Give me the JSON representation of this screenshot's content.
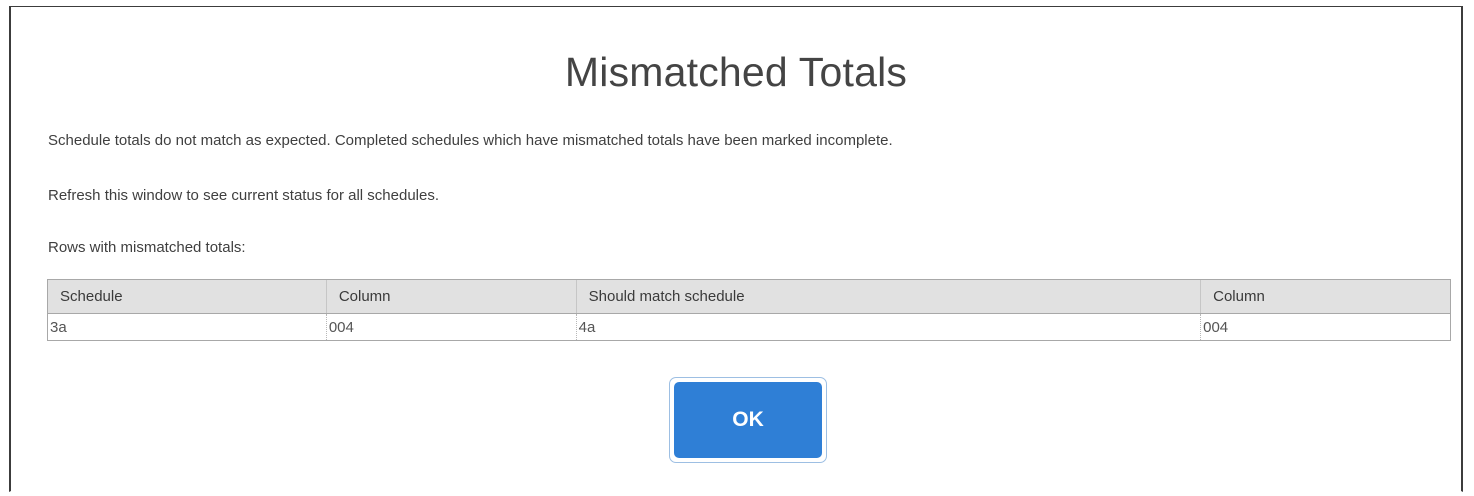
{
  "dialog": {
    "title": "Mismatched Totals",
    "message_1": "Schedule totals do not match as expected. Completed schedules which have mismatched totals have been marked incomplete.",
    "message_2": "Refresh this window to see current status for all schedules.",
    "message_3": "Rows with mismatched totals:",
    "table": {
      "headers": [
        "Schedule",
        "Column",
        "Should match schedule",
        "Column"
      ],
      "rows": [
        [
          "3a",
          "004",
          "4a",
          "004"
        ]
      ]
    },
    "ok_label": "OK"
  },
  "colors": {
    "accent": "#2f7fd6",
    "header_bg": "#e1e1e1"
  }
}
